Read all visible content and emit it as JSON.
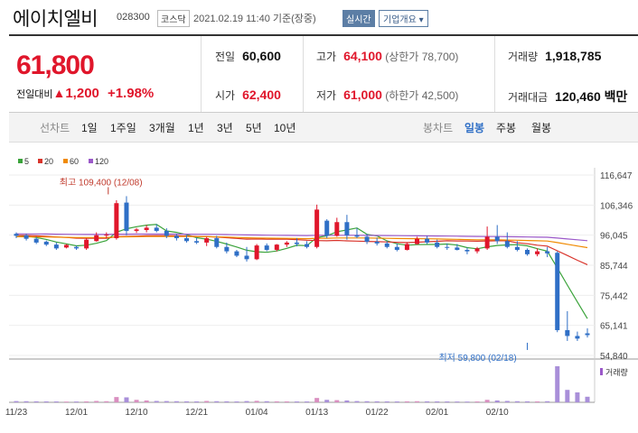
{
  "header": {
    "name": "에이치엘비",
    "code": "028300",
    "market": "코스닥",
    "datetime": "2021.02.19 11:40 기준(장중)",
    "realtime_label": "실시간",
    "company_label": "기업개요 ▾"
  },
  "price": {
    "current": "61,800",
    "change_label": "전일대비",
    "change_arrow": "▲",
    "change": "1,200",
    "pct": "+1.98%"
  },
  "stats": {
    "prev_label": "전일",
    "prev": "60,600",
    "open_label": "시가",
    "open": "62,400",
    "high_label": "고가",
    "high": "64,100",
    "upper_limit": "(상한가 78,700)",
    "low_label": "저가",
    "low": "61,000",
    "lower_limit": "(하한가 42,500)",
    "volume_label": "거래량",
    "volume": "1,918,785",
    "amount_label": "거래대금",
    "amount": "120,460 백만"
  },
  "tabs": {
    "line_label": "선차트",
    "line_periods": [
      "1일",
      "1주일",
      "3개월",
      "1년",
      "3년",
      "5년",
      "10년"
    ],
    "candle_label": "봉차트",
    "candle_periods": [
      "일봉",
      "주봉",
      "월봉"
    ],
    "active_candle": "일봉"
  },
  "chart_data": {
    "type": "candlestick",
    "legend": [
      {
        "name": "5",
        "color": "#3aa33a"
      },
      {
        "name": "20",
        "color": "#d9342b"
      },
      {
        "name": "60",
        "color": "#f08a00"
      },
      {
        "name": "120",
        "color": "#9b59c9"
      }
    ],
    "up_color": "#e0162b",
    "down_color": "#2f6fc6",
    "y_ticks": [
      116647,
      106346,
      96045,
      85744,
      75442,
      65141,
      54840
    ],
    "y_range": [
      54840,
      116647
    ],
    "x_ticks": [
      "11/23",
      "12/01",
      "12/10",
      "12/21",
      "01/04",
      "01/13",
      "01/22",
      "02/01",
      "02/10"
    ],
    "x_tick_index": [
      0,
      6,
      12,
      18,
      24,
      30,
      36,
      42,
      48
    ],
    "high_label": "최고 109,400 (12/08)",
    "high_index": 9,
    "high_value": 109400,
    "low_label": "최저 59,800 (02/18)",
    "low_index": 51,
    "low_value": 59800,
    "volume_label": "거래량",
    "ohlc": [
      [
        96500,
        97000,
        95000,
        95800
      ],
      [
        96000,
        96500,
        94200,
        94800
      ],
      [
        94800,
        95500,
        93000,
        93500
      ],
      [
        93800,
        94200,
        92300,
        92800
      ],
      [
        92800,
        93500,
        91000,
        91500
      ],
      [
        91800,
        93000,
        91500,
        92700
      ],
      [
        92000,
        92500,
        91000,
        91500
      ],
      [
        91500,
        95000,
        91000,
        94500
      ],
      [
        94000,
        97000,
        93800,
        96000
      ],
      [
        96000,
        97000,
        95000,
        96200
      ],
      [
        95000,
        108000,
        94500,
        107000
      ],
      [
        107200,
        109400,
        96000,
        97500
      ],
      [
        97500,
        98500,
        96800,
        98000
      ],
      [
        97800,
        99500,
        97000,
        98600
      ],
      [
        98600,
        99800,
        97000,
        97500
      ],
      [
        97500,
        98400,
        95000,
        95800
      ],
      [
        95800,
        96500,
        94200,
        95000
      ],
      [
        95000,
        96000,
        93500,
        94000
      ],
      [
        94000,
        95200,
        93000,
        93500
      ],
      [
        93500,
        95500,
        92300,
        95000
      ],
      [
        95000,
        95800,
        91500,
        92000
      ],
      [
        92000,
        93500,
        89800,
        90500
      ],
      [
        90500,
        91000,
        88500,
        89000
      ],
      [
        89000,
        92000,
        87000,
        87800
      ],
      [
        87800,
        93000,
        87500,
        92500
      ],
      [
        92500,
        93200,
        90500,
        91000
      ],
      [
        91000,
        93000,
        90500,
        92800
      ],
      [
        92800,
        94000,
        92000,
        93500
      ],
      [
        93500,
        95000,
        92200,
        93000
      ],
      [
        93000,
        94000,
        91500,
        92000
      ],
      [
        92000,
        106500,
        91500,
        104800
      ],
      [
        101000,
        101500,
        95000,
        95800
      ],
      [
        95800,
        102000,
        95500,
        100500
      ],
      [
        100500,
        103000,
        94500,
        96000
      ],
      [
        96000,
        98500,
        95000,
        95500
      ],
      [
        95500,
        96500,
        93000,
        93800
      ],
      [
        93800,
        95200,
        92500,
        93200
      ],
      [
        93200,
        94000,
        91500,
        92000
      ],
      [
        92000,
        93200,
        90500,
        91000
      ],
      [
        91000,
        93500,
        90800,
        93000
      ],
      [
        93000,
        95500,
        92800,
        94800
      ],
      [
        94800,
        95800,
        93000,
        93500
      ],
      [
        93500,
        94500,
        91500,
        92000
      ],
      [
        92000,
        93200,
        91000,
        91800
      ],
      [
        91800,
        93000,
        90800,
        91000
      ],
      [
        91000,
        91800,
        89500,
        90500
      ],
      [
        90500,
        92000,
        89800,
        91500
      ],
      [
        91500,
        99000,
        91000,
        95500
      ],
      [
        95500,
        99500,
        93000,
        94000
      ],
      [
        94000,
        97000,
        91500,
        92000
      ],
      [
        92000,
        94000,
        90500,
        91000
      ],
      [
        91000,
        91500,
        89000,
        89500
      ],
      [
        89500,
        91500,
        88800,
        90500
      ],
      [
        90500,
        92000,
        88500,
        89800
      ],
      [
        90000,
        90500,
        62800,
        63500
      ],
      [
        63500,
        70000,
        59800,
        61500
      ],
      [
        61500,
        63000,
        59800,
        60600
      ],
      [
        62400,
        64100,
        61000,
        61800
      ]
    ],
    "volume": [
      20,
      18,
      16,
      15,
      14,
      12,
      13,
      15,
      22,
      18,
      85,
      80,
      40,
      30,
      22,
      20,
      18,
      16,
      15,
      22,
      18,
      16,
      14,
      20,
      24,
      18,
      16,
      15,
      14,
      14,
      70,
      40,
      35,
      30,
      20,
      18,
      16,
      15,
      14,
      16,
      18,
      16,
      15,
      14,
      13,
      12,
      14,
      40,
      30,
      22,
      18,
      16,
      15,
      18,
      580,
      200,
      160,
      90
    ]
  }
}
